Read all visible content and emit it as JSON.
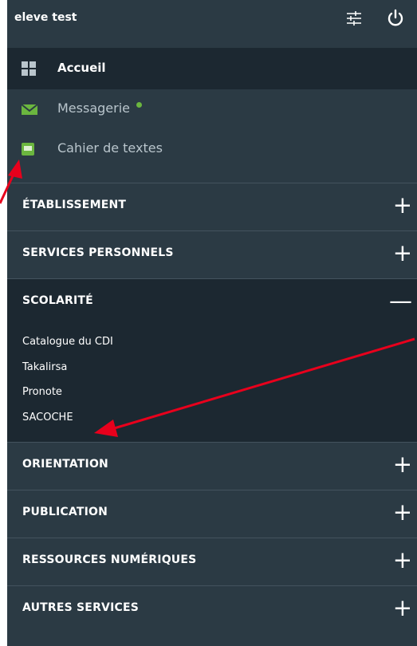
{
  "user": {
    "name": "eleve test"
  },
  "top_icons": {
    "settings": "sliders-icon",
    "power": "power-icon"
  },
  "nav": {
    "home": {
      "label": "Accueil",
      "icon": "grid-icon"
    },
    "quick_links": [
      {
        "label": "Messagerie",
        "icon": "mail-icon",
        "status_color": "#6bb63f"
      },
      {
        "label": "Cahier de textes",
        "icon": "notebook-icon"
      }
    ]
  },
  "sections": [
    {
      "label": "ÉTABLISSEMENT",
      "toggle": "+"
    },
    {
      "label": "SERVICES PERSONNELS",
      "toggle": "+"
    },
    {
      "label": "SCOLARITÉ",
      "toggle": "—",
      "items": [
        "Catalogue du CDI",
        "Takalirsa",
        "Pronote",
        "SACOCHE"
      ]
    },
    {
      "label": "ORIENTATION",
      "toggle": "+"
    },
    {
      "label": "PUBLICATION",
      "toggle": "+"
    },
    {
      "label": "RESSOURCES NUMÉRIQUES",
      "toggle": "+"
    },
    {
      "label": "AUTRES SERVICES",
      "toggle": "+"
    }
  ],
  "colors": {
    "panel": "#2b3a44",
    "panel_dark": "#1c2831",
    "accent_green": "#6bb63f",
    "annotation_arrow": "#e8001c"
  }
}
